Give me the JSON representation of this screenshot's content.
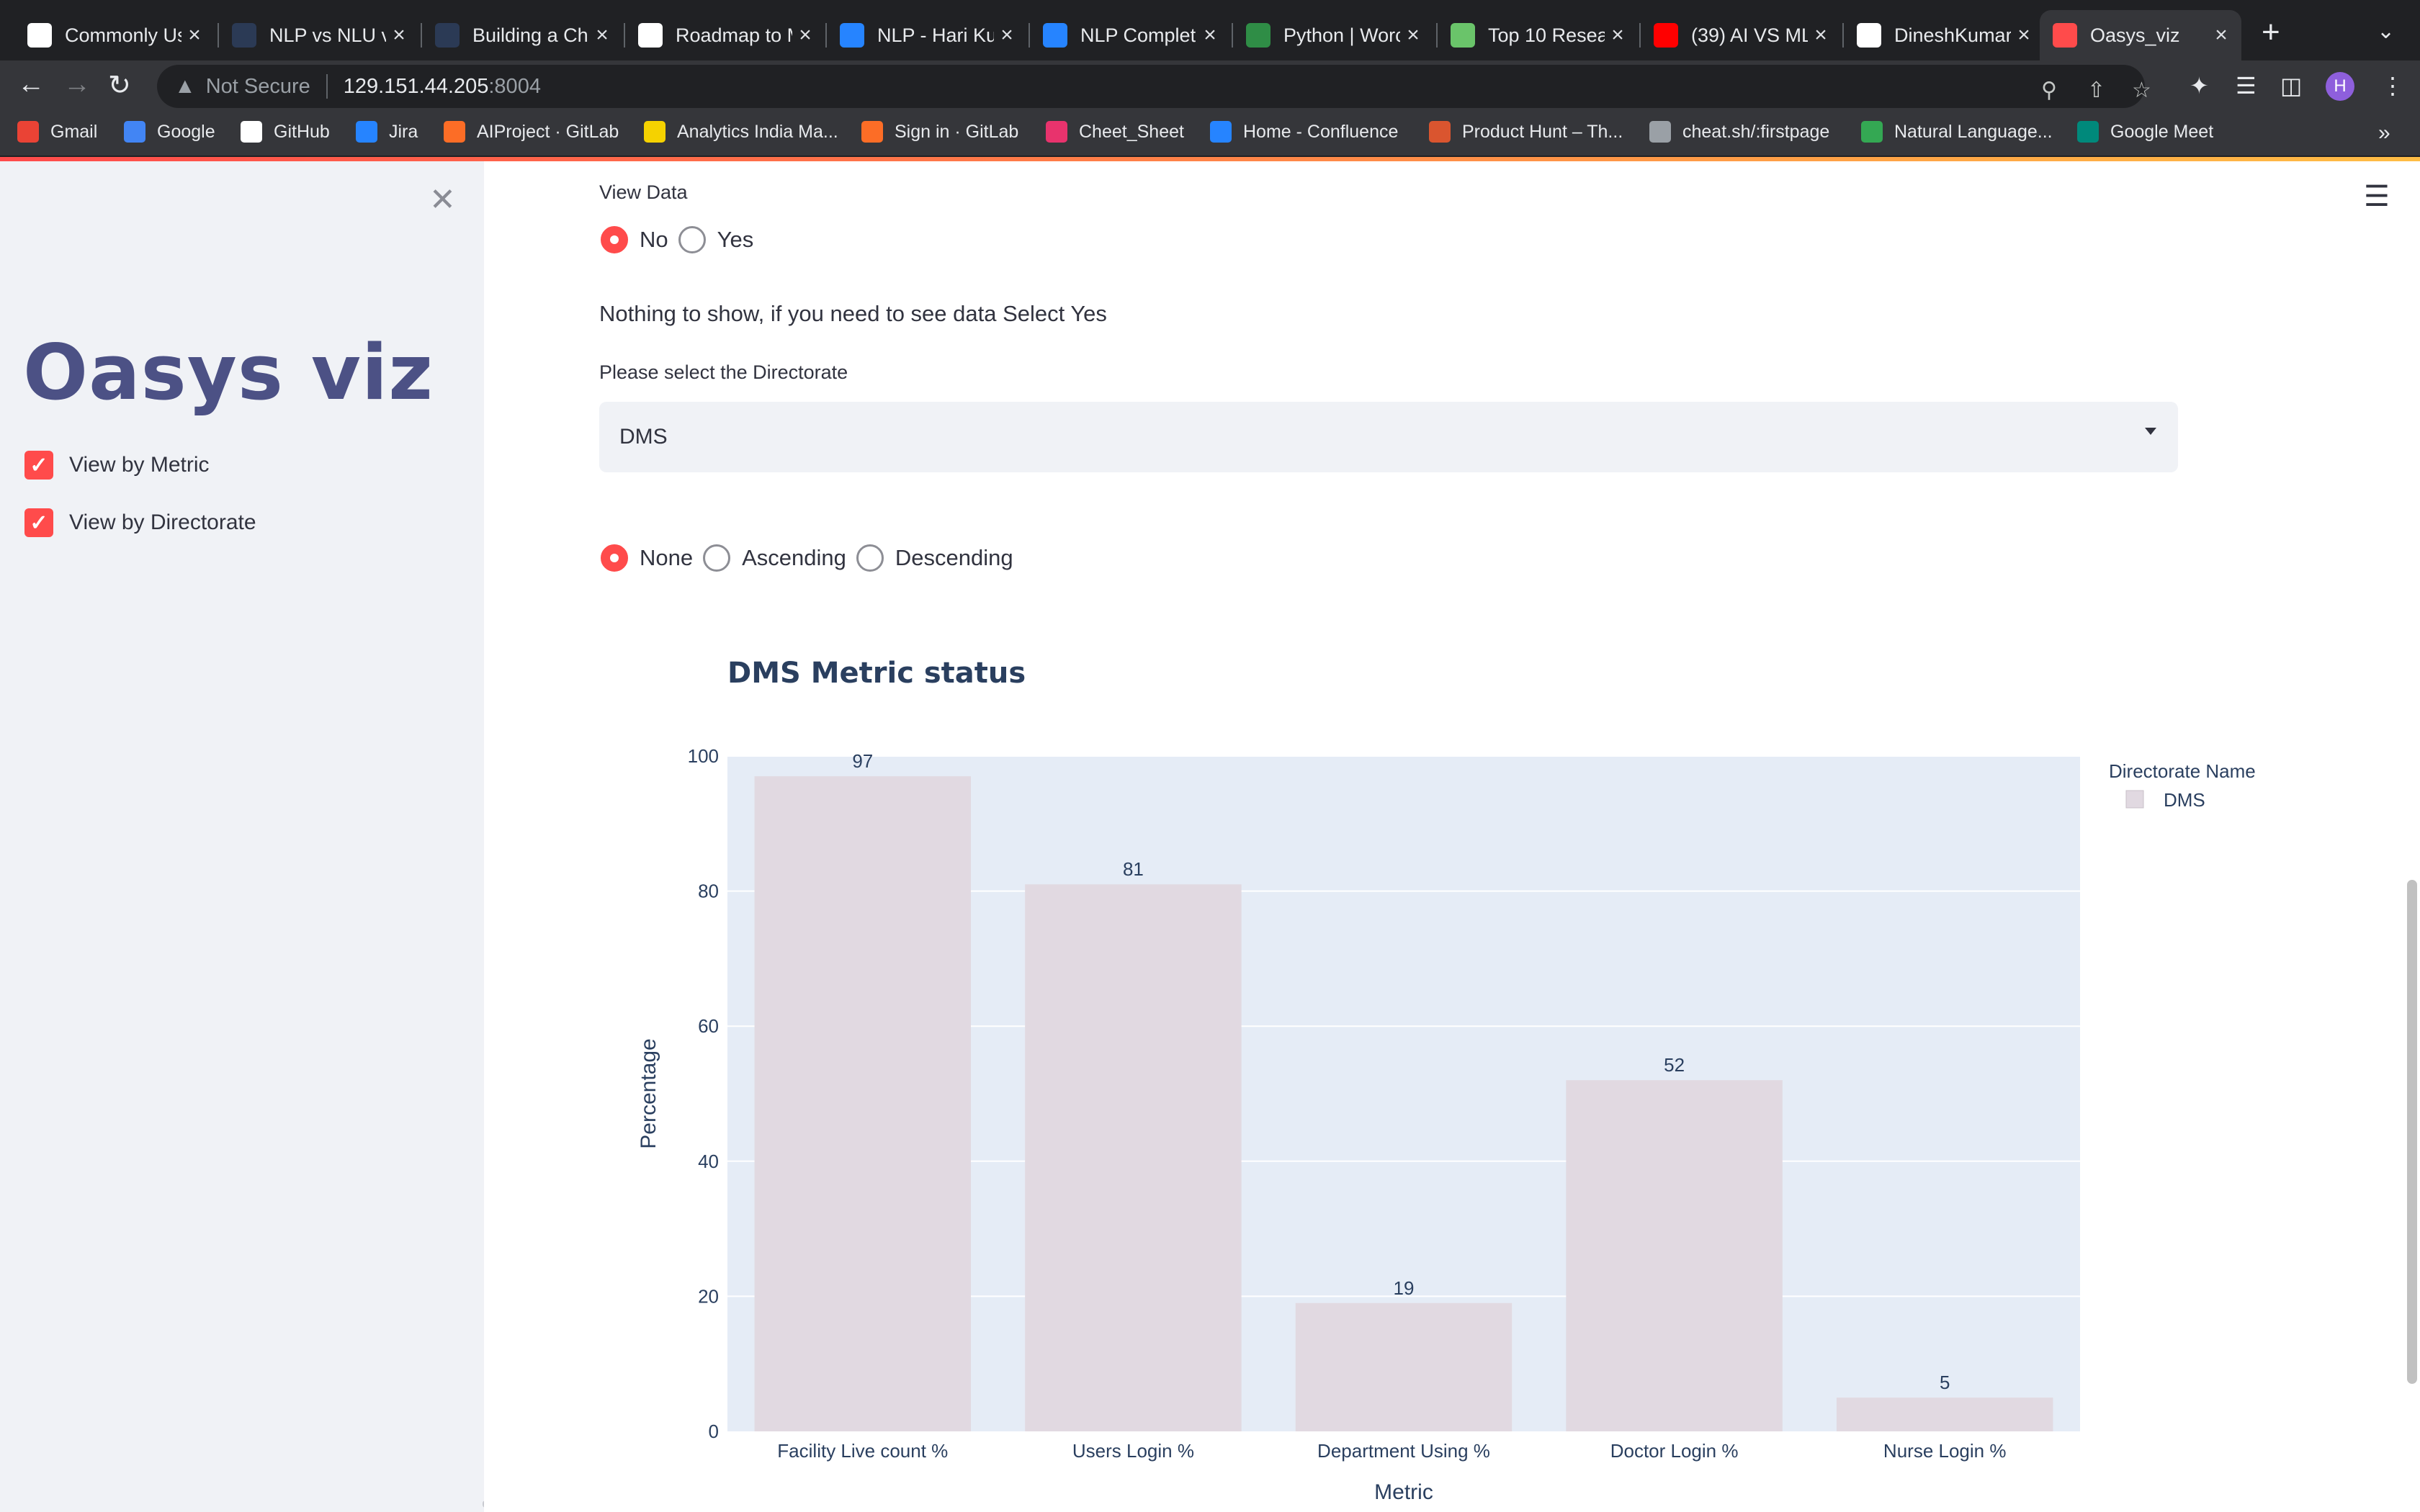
{
  "browser": {
    "tabs": [
      {
        "title": "Commonly Us",
        "fav": "#ffffff",
        "favtext": ""
      },
      {
        "title": "NLP vs NLU v",
        "fav": "#2b3a55",
        "favtext": "tds"
      },
      {
        "title": "Building a Ch",
        "fav": "#2b3a55",
        "favtext": "tds"
      },
      {
        "title": "Roadmap to M",
        "fav": "#ffffff",
        "favtext": ""
      },
      {
        "title": "NLP - Hari Ku",
        "fav": "#2684ff",
        "favtext": ""
      },
      {
        "title": "NLP Complet",
        "fav": "#2684ff",
        "favtext": ""
      },
      {
        "title": "Python | Worc",
        "fav": "#2f8d46",
        "favtext": ""
      },
      {
        "title": "Top 10 Resea",
        "fav": "#6ac46a",
        "favtext": ""
      },
      {
        "title": "(39) AI VS ML",
        "fav": "#ff0000",
        "favtext": ""
      },
      {
        "title": "DineshKumar",
        "fav": "#ffffff",
        "favtext": ""
      },
      {
        "title": "Oasys_viz",
        "fav": "#ff4b4b",
        "favtext": ""
      }
    ],
    "address": {
      "security": "Not Secure",
      "host": "129.151.44.205",
      "port": ":8004"
    },
    "bookmarks": [
      {
        "label": "Gmail",
        "color": "#ea4335"
      },
      {
        "label": "Google",
        "color": "#4285f4"
      },
      {
        "label": "GitHub",
        "color": "#ffffff"
      },
      {
        "label": "Jira",
        "color": "#2684ff"
      },
      {
        "label": "AIProject · GitLab",
        "color": "#fc6d26"
      },
      {
        "label": "Analytics India Ma...",
        "color": "#f5d200"
      },
      {
        "label": "Sign in · GitLab",
        "color": "#fc6d26"
      },
      {
        "label": "Cheet_Sheet",
        "color": "#e8336d"
      },
      {
        "label": "Home - Confluence",
        "color": "#2684ff"
      },
      {
        "label": "Product Hunt – Th...",
        "color": "#da552f"
      },
      {
        "label": "cheat.sh/:firstpage",
        "color": "#9aa0a6"
      },
      {
        "label": "Natural Language...",
        "color": "#34a853"
      },
      {
        "label": "Google Meet",
        "color": "#00897b"
      }
    ]
  },
  "sidebar": {
    "title": "Oasys viz",
    "checkboxes": [
      {
        "label": "View by Metric",
        "checked": true
      },
      {
        "label": "View by Directorate",
        "checked": true
      }
    ]
  },
  "main": {
    "view_data": {
      "label": "View Data",
      "options": [
        "No",
        "Yes"
      ],
      "selected": "No"
    },
    "message": "Nothing to show, if you need to see data Select Yes",
    "directorate": {
      "label": "Please select the Directorate",
      "value": "DMS"
    },
    "sort": {
      "options": [
        "None",
        "Ascending",
        "Descending"
      ],
      "selected": "None"
    }
  },
  "chart_data": {
    "type": "bar",
    "title": "DMS Metric status",
    "categories": [
      "Facility Live count %",
      "Users Login  %",
      "Department Using %",
      "Doctor Login %",
      "Nurse Login %"
    ],
    "series": [
      {
        "name": "DMS",
        "values": [
          97,
          81,
          19,
          52,
          5
        ],
        "color": "#e1d9e1"
      }
    ],
    "data_labels": [
      "97",
      "81",
      "19",
      "52",
      "5"
    ],
    "xlabel": "Metric",
    "ylabel": "Percentage",
    "ylim": [
      0,
      100
    ],
    "yticks": [
      0,
      20,
      40,
      60,
      80,
      100
    ],
    "legend_title": "Directorate Name",
    "legend_position": "top-right",
    "grid": true,
    "plot_bg": "#e5ecf6"
  }
}
